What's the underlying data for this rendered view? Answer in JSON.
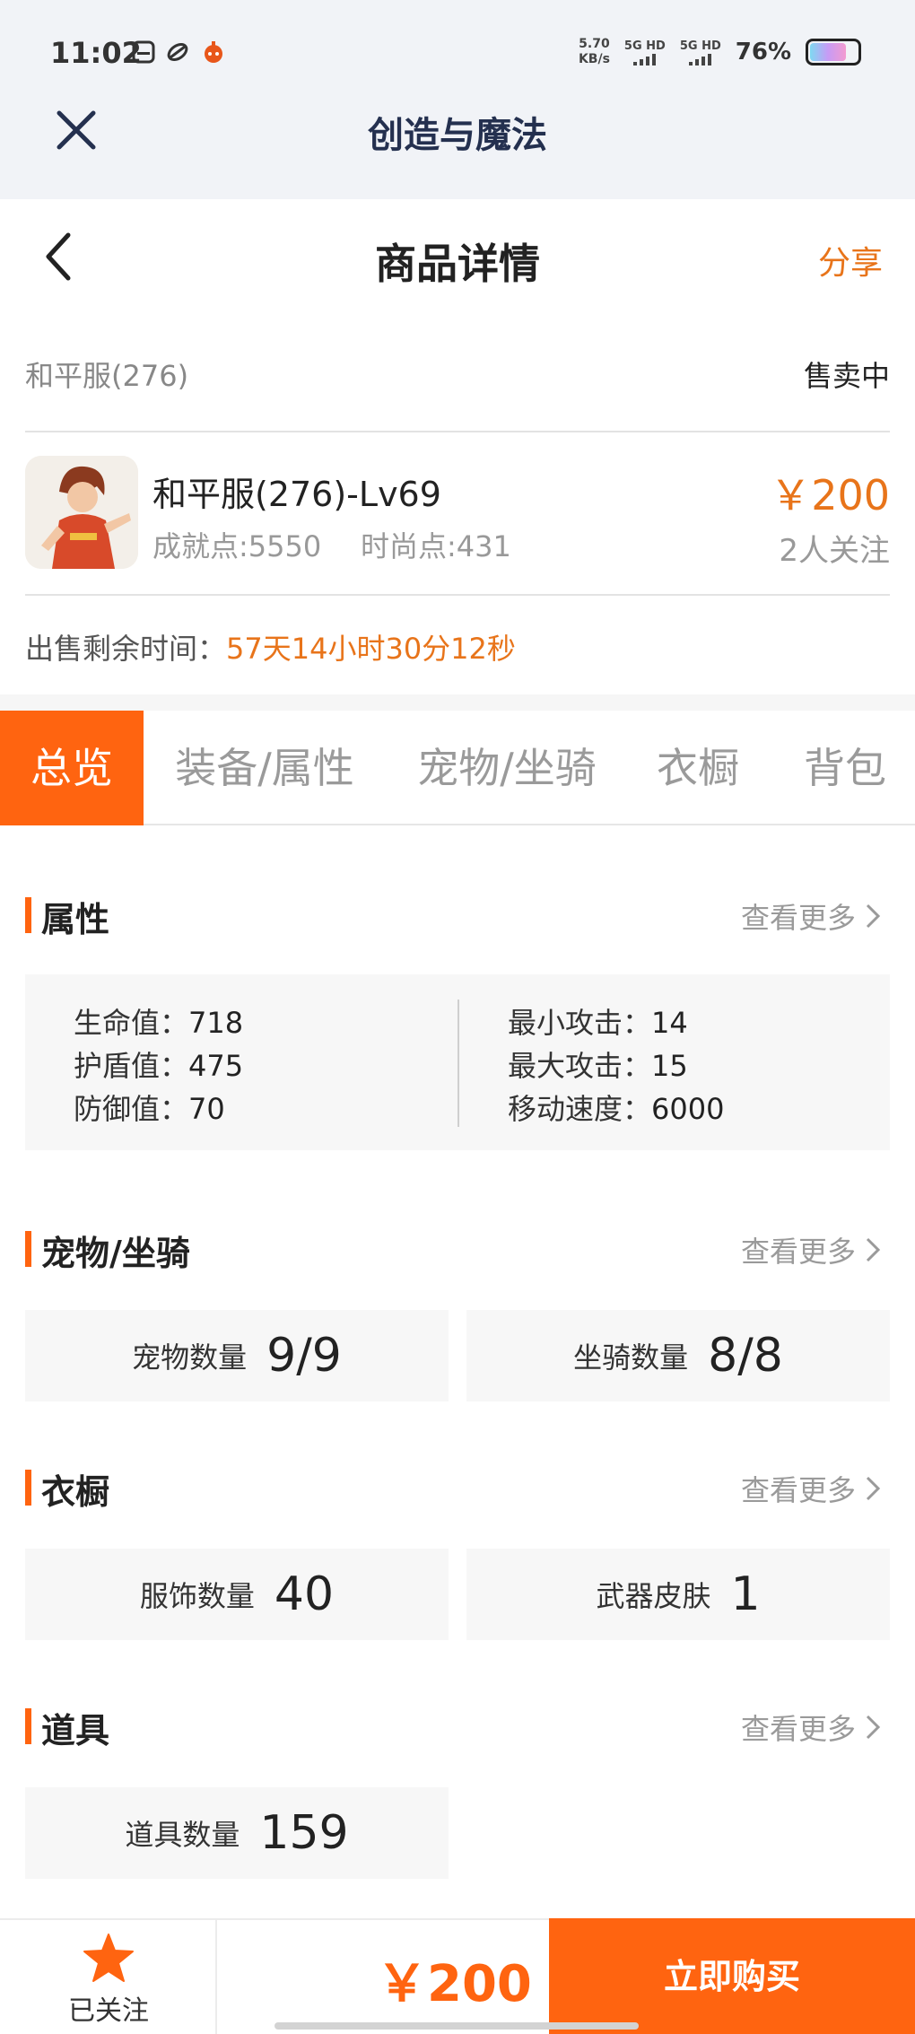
{
  "status_bar": {
    "time": "11:02",
    "speed_value": "5.70",
    "speed_unit": "KB/s",
    "sim1_label": "5G HD",
    "sim2_label": "5G HD",
    "battery_pct": "76%",
    "battery_level": 0.76
  },
  "app_bar": {
    "title": "创造与魔法"
  },
  "header": {
    "title": "商品详情",
    "share_label": "分享"
  },
  "listing": {
    "server": "和平服(276)",
    "status": "售卖中",
    "name": "和平服(276)-Lv69",
    "achievement": "成就点:5550",
    "fashion": "时尚点:431",
    "price": "￥200",
    "followers": "2人关注",
    "remaining_label": "出售剩余时间：",
    "remaining_value": "57天14小时30分12秒"
  },
  "tabs": [
    {
      "label": "总览",
      "active": true
    },
    {
      "label": "装备/属性",
      "active": false
    },
    {
      "label": "宠物/坐骑",
      "active": false
    },
    {
      "label": "衣橱",
      "active": false
    },
    {
      "label": "背包",
      "active": false
    }
  ],
  "sections": {
    "more_label": "查看更多",
    "attributes": {
      "title": "属性",
      "left": [
        {
          "label": "生命值：",
          "value": "718"
        },
        {
          "label": "护盾值：",
          "value": "475"
        },
        {
          "label": "防御值：",
          "value": "70"
        }
      ],
      "right": [
        {
          "label": "最小攻击：",
          "value": "14"
        },
        {
          "label": "最大攻击：",
          "value": "15"
        },
        {
          "label": "移动速度：",
          "value": "6000"
        }
      ]
    },
    "pets": {
      "title": "宠物/坐骑",
      "pet_label": "宠物数量",
      "pet_value": "9/9",
      "mount_label": "坐骑数量",
      "mount_value": "8/8"
    },
    "wardrobe": {
      "title": "衣橱",
      "outfit_label": "服饰数量",
      "outfit_value": "40",
      "skin_label": "武器皮肤",
      "skin_value": "1"
    },
    "items": {
      "title": "道具",
      "count_label": "道具数量",
      "count_value": "159"
    }
  },
  "bottom_bar": {
    "follow_label": "已关注",
    "price": "￥200",
    "buy_label": "立即购买"
  },
  "colors": {
    "accent": "#ff6410",
    "price": "#e8741a"
  }
}
